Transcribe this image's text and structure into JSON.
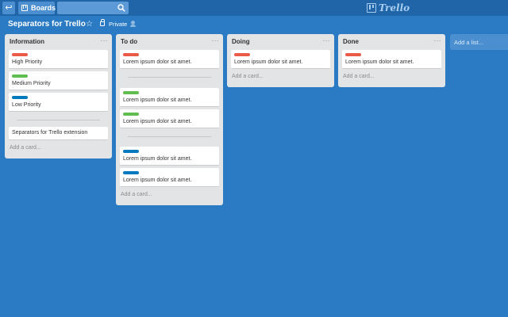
{
  "topbar": {
    "back_icon": "arrow-left-icon",
    "boards_label": "Boards",
    "search_placeholder": "",
    "logo": "Trello"
  },
  "board": {
    "title": "Separators for Trello",
    "visibility": "Private"
  },
  "lists": [
    {
      "title": "Information",
      "menu": "…",
      "add_card": "Add a card...",
      "cards": [
        {
          "label_color": "#eb5a46",
          "text": "High Priority"
        },
        {
          "label_color": "#61bd4f",
          "text": "Medium Priority"
        },
        {
          "label_color": "#0079bf",
          "text": "Low Priority"
        },
        {
          "text": "Separators for Trello extension"
        }
      ]
    },
    {
      "title": "To do",
      "menu": "…",
      "add_card": "Add a card...",
      "cards": [
        {
          "label_color": "#eb5a46",
          "text": "Lorem ipsum dolor sit amet."
        },
        {
          "label_color": "#61bd4f",
          "text": "Lorem ipsum dolor sit amet."
        },
        {
          "label_color": "#61bd4f",
          "text": "Lorem ipsum dolor sit amet."
        },
        {
          "label_color": "#0079bf",
          "text": "Lorem ipsum dolor sit amet."
        },
        {
          "label_color": "#0079bf",
          "text": "Lorem ipsum dolor sit amet."
        }
      ]
    },
    {
      "title": "Doing",
      "menu": "…",
      "add_card": "Add a card...",
      "cards": [
        {
          "label_color": "#eb5a46",
          "text": "Lorem ipsum dolor sit amet."
        }
      ]
    },
    {
      "title": "Done",
      "menu": "…",
      "add_card": "Add a card...",
      "cards": [
        {
          "label_color": "#eb5a46",
          "text": "Lorem ipsum dolor sit amet."
        }
      ]
    }
  ],
  "add_list": "Add a list..."
}
